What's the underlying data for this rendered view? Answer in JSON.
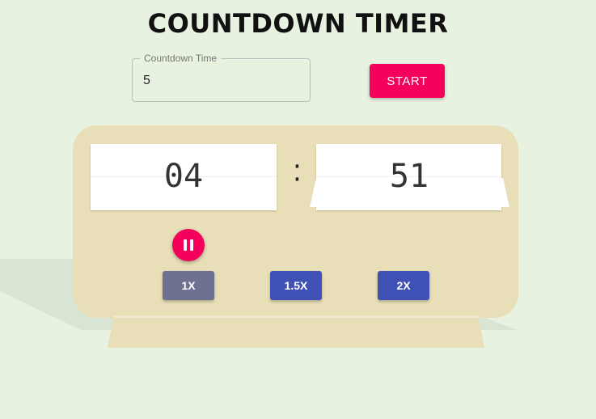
{
  "page": {
    "title": "COUNTDOWN TIMER"
  },
  "form": {
    "legend": "Countdown Time",
    "value": "5",
    "start_label": "START"
  },
  "timer": {
    "minutes": "04",
    "separator": ":",
    "seconds": "51",
    "state": "running",
    "pause_icon": "pause-icon"
  },
  "speed": {
    "options": [
      "1X",
      "1.5X",
      "2X"
    ],
    "selected": "1X",
    "colors": {
      "selected": "#6e7190",
      "default": "#3f51b5"
    }
  },
  "colors": {
    "background": "#e8f2e1",
    "accent": "#f5005a",
    "clock_body": "#e8deb7"
  }
}
